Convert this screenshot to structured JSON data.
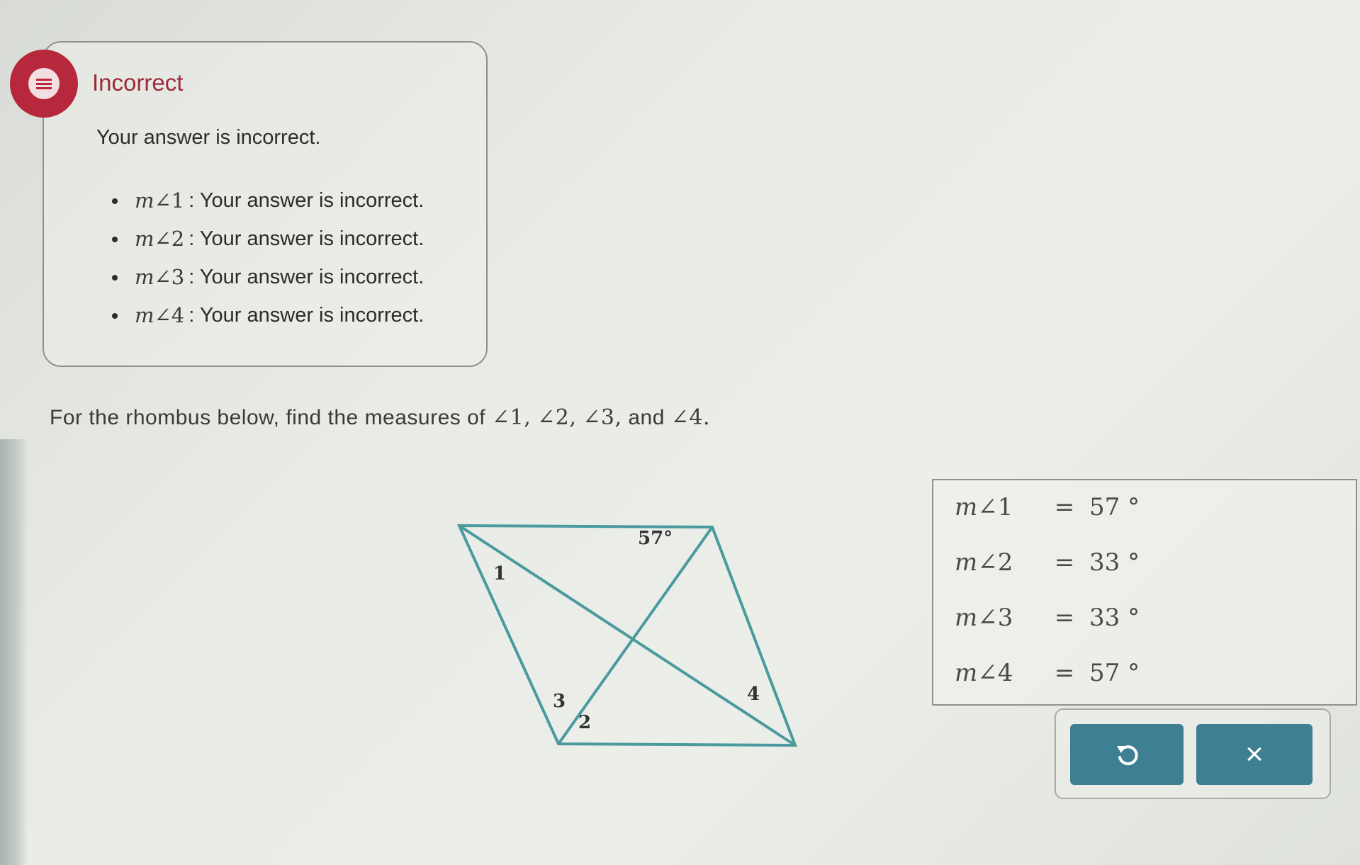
{
  "feedback": {
    "title": "Incorrect",
    "subtitle": "Your answer is incorrect.",
    "items": [
      {
        "m": "m",
        "angle": "∠1",
        "text": ": Your answer is incorrect."
      },
      {
        "m": "m",
        "angle": "∠2",
        "text": ": Your answer is incorrect."
      },
      {
        "m": "m",
        "angle": "∠3",
        "text": ": Your answer is incorrect."
      },
      {
        "m": "m",
        "angle": "∠4",
        "text": ": Your answer is incorrect."
      }
    ]
  },
  "question": {
    "prefix": "For the rhombus below, find the measures of",
    "a1": "∠1,",
    "a2": "∠2,",
    "a3": "∠3,",
    "and": "and",
    "a4": "∠4."
  },
  "figure": {
    "given_angle": "57°",
    "labels": [
      "1",
      "2",
      "3",
      "4"
    ]
  },
  "answers": [
    {
      "label_m": "m",
      "label_angle": "∠1",
      "eq": "=",
      "value": "57 °"
    },
    {
      "label_m": "m",
      "label_angle": "∠2",
      "eq": "=",
      "value": "33 °"
    },
    {
      "label_m": "m",
      "label_angle": "∠3",
      "eq": "=",
      "value": "33 °"
    },
    {
      "label_m": "m",
      "label_angle": "∠4",
      "eq": "=",
      "value": "57 °"
    }
  ],
  "buttons": {
    "undo_icon": "undo-icon",
    "clear_icon": "close-icon",
    "clear_symbol": "×",
    "color": "#3f7f93"
  },
  "colors": {
    "incorrect": "#b8283c",
    "title": "#9e2a3a"
  }
}
